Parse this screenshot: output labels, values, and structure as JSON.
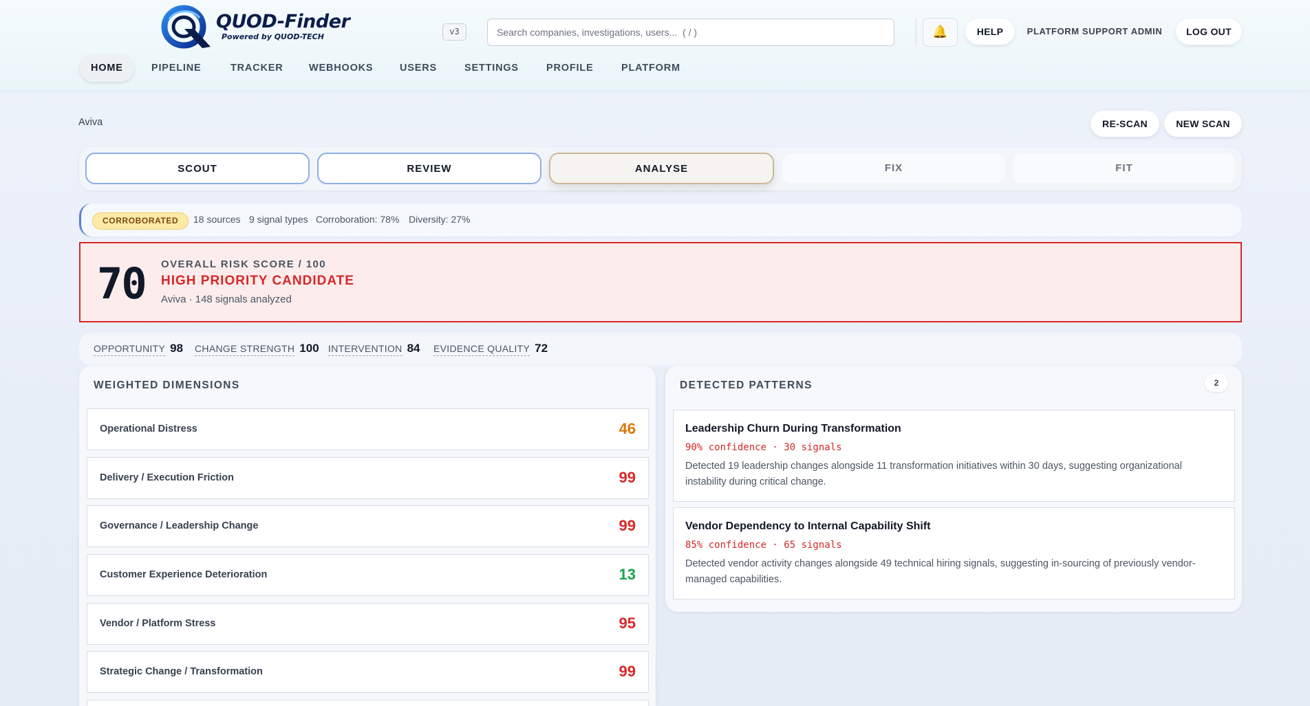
{
  "app": {
    "brand": "QUOD-Finder",
    "tagline": "Powered by QUOD-TECH",
    "version": "v3"
  },
  "header": {
    "search_placeholder": "Search companies, investigations, users...  ( / )",
    "bell_icon": "bell-icon",
    "help_label": "HELP",
    "user_label": "PLATFORM SUPPORT ADMIN",
    "logout_label": "LOG OUT"
  },
  "nav": {
    "items": [
      {
        "label": "HOME",
        "active": true
      },
      {
        "label": "PIPELINE"
      },
      {
        "label": "TRACKER"
      },
      {
        "label": "WEBHOOKS"
      },
      {
        "label": "USERS"
      },
      {
        "label": "SETTINGS"
      },
      {
        "label": "PROFILE"
      },
      {
        "label": "PLATFORM"
      }
    ]
  },
  "page": {
    "company": "Aviva",
    "rescan_label": "RE-SCAN",
    "newscan_label": "NEW SCAN"
  },
  "stages": [
    {
      "label": "SCOUT",
      "state": "done"
    },
    {
      "label": "REVIEW",
      "state": "done"
    },
    {
      "label": "ANALYSE",
      "state": "active"
    },
    {
      "label": "FIX",
      "state": "todo"
    },
    {
      "label": "FIT",
      "state": "todo"
    }
  ],
  "corroboration": {
    "badge": "CORROBORATED",
    "sources": "18 sources",
    "signal_types": "9 signal types",
    "corroboration": "Corroboration: 78%",
    "diversity": "Diversity: 27%"
  },
  "risk": {
    "score": "70",
    "label": "OVERALL RISK SCORE / 100",
    "title": "HIGH PRIORITY CANDIDATE",
    "subtitle": "Aviva · 148 signals analyzed"
  },
  "metrics": [
    {
      "label": "OPPORTUNITY",
      "value": "98"
    },
    {
      "label": "CHANGE STRENGTH",
      "value": "100"
    },
    {
      "label": "INTERVENTION",
      "value": "84"
    },
    {
      "label": "EVIDENCE QUALITY",
      "value": "72"
    }
  ],
  "dimensions": {
    "title": "WEIGHTED DIMENSIONS",
    "items": [
      {
        "name": "Operational Distress",
        "score": "46",
        "color": "#d97706"
      },
      {
        "name": "Delivery / Execution Friction",
        "score": "99",
        "color": "#dc2626"
      },
      {
        "name": "Governance / Leadership Change",
        "score": "99",
        "color": "#dc2626"
      },
      {
        "name": "Customer Experience Deterioration",
        "score": "13",
        "color": "#16a34a"
      },
      {
        "name": "Vendor / Platform Stress",
        "score": "95",
        "color": "#dc2626"
      },
      {
        "name": "Strategic Change / Transformation",
        "score": "99",
        "color": "#dc2626"
      }
    ]
  },
  "patterns": {
    "title": "DETECTED PATTERNS",
    "count": "2",
    "items": [
      {
        "title": "Leadership Churn During Transformation",
        "meta": "90% confidence · 30 signals",
        "description": "Detected 19 leadership changes alongside 11 transformation initiatives within 30 days, suggesting organizational instability during critical change."
      },
      {
        "title": "Vendor Dependency to Internal Capability Shift",
        "meta": "85% confidence · 65 signals",
        "description": "Detected vendor activity changes alongside 49 technical hiring signals, suggesting in-sourcing of previously vendor-managed capabilities."
      }
    ]
  },
  "colors": {
    "accent_blue": "#5a7fd0",
    "danger": "#d62828",
    "warning": "#d97706",
    "success": "#16a34a"
  }
}
